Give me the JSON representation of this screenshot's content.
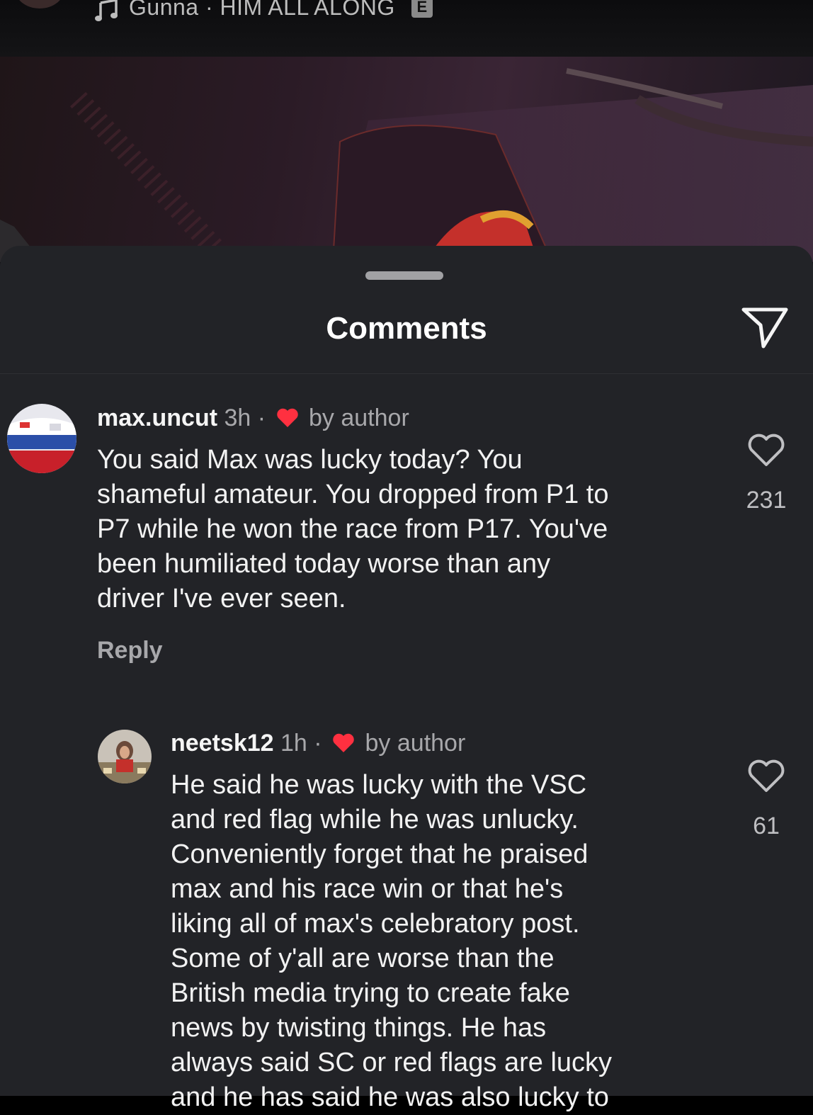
{
  "music_bar": {
    "artist": "Gunna",
    "separator": "·",
    "song": "HIM ALL ALONG",
    "explicit_badge": "E",
    "icon": "music-note-icon"
  },
  "sheet": {
    "title": "Comments",
    "share_icon": "send-icon"
  },
  "comments": [
    {
      "username": "max.uncut",
      "time": "3h",
      "separator": "·",
      "liked_by": "by author",
      "text": "You said Max was lucky today? You\nshameful amateur. You dropped from P1 to\nP7 while he won the race from P17. You've\nbeen humiliated today worse than any\ndriver I've ever seen.",
      "reply_label": "Reply",
      "likes": "231"
    },
    {
      "username": "neetsk12",
      "time": "1h",
      "separator": "·",
      "liked_by": "by author",
      "text": "He said he was lucky with the VSC\nand red flag while he was unlucky.\nConveniently forget that he praised\nmax and his race win or that he's\nliking all of max's celebratory post.\nSome of y'all are worse than the\nBritish media trying to create fake\nnews by twisting things. He has\nalways said SC or red flags are lucky\nand he has said he was also lucky to",
      "likes": "61"
    }
  ],
  "colors": {
    "sheet_bg": "#222327",
    "heart_red": "#ff3040",
    "muted_text": "#a8a8ab"
  }
}
